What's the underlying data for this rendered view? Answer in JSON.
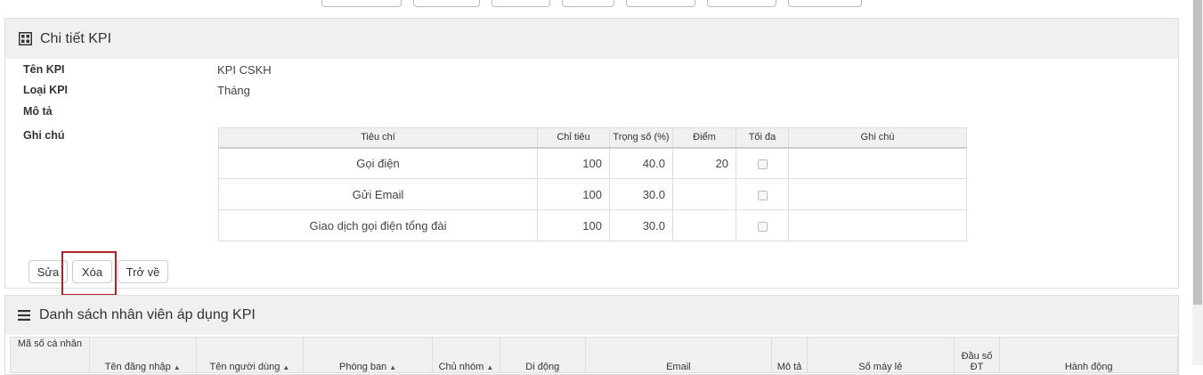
{
  "detail_panel": {
    "title": "Chi tiết KPI",
    "fields": [
      {
        "label": "Tên KPI",
        "value": "KPI CSKH"
      },
      {
        "label": "Loại KPI",
        "value": "Tháng"
      },
      {
        "label": "Mô tả",
        "value": ""
      },
      {
        "label": "Ghi chú",
        "value": ""
      }
    ],
    "criteria_table": {
      "headers": [
        "Tiêu chí",
        "Chỉ tiêu",
        "Trọng số (%)",
        "Điểm",
        "Tối đa",
        "Ghi chú"
      ],
      "rows": [
        {
          "criterion": "Gọi điện",
          "target": "100",
          "weight": "40.0",
          "score": "20",
          "max": false,
          "note": ""
        },
        {
          "criterion": "Gửi Email",
          "target": "100",
          "weight": "30.0",
          "score": "",
          "max": false,
          "note": ""
        },
        {
          "criterion": "Giao dịch gọi điện tổng đài",
          "target": "100",
          "weight": "30.0",
          "score": "",
          "max": false,
          "note": ""
        }
      ]
    },
    "buttons": {
      "edit": "Sửa",
      "delete": "Xóa",
      "back": "Trở về"
    }
  },
  "employee_panel": {
    "title": "Danh sách nhân viên áp dụng KPI",
    "table_headers": [
      "Mã số cá nhân",
      "Tên đăng nhập",
      "Tên người dùng",
      "Phòng ban",
      "Chủ nhóm",
      "Di động",
      "Email",
      "Mô tả",
      "Số máy lẻ",
      "Đầu số ĐT",
      "Hành động"
    ]
  },
  "colors": {
    "highlight": "#b22222",
    "header_bg": "#f0f0f0"
  }
}
